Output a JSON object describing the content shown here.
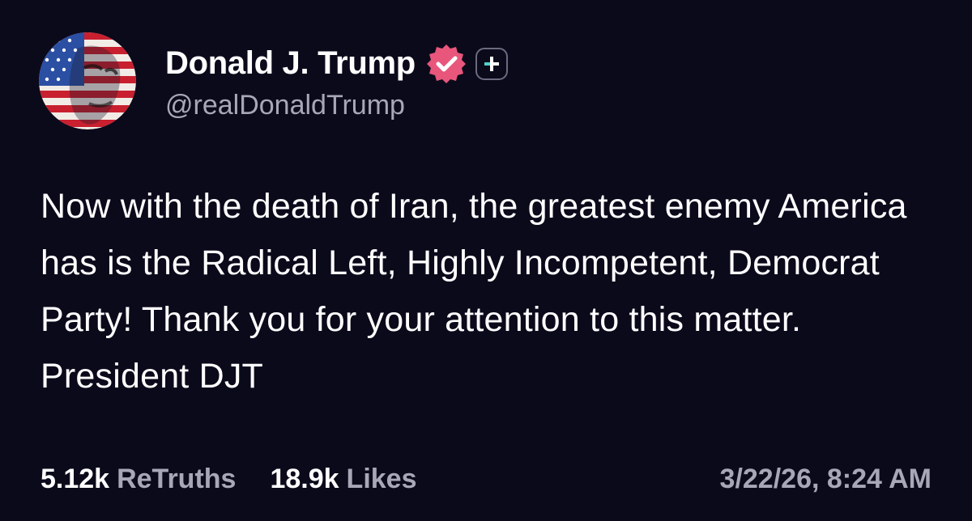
{
  "post": {
    "author": {
      "display_name": "Donald J. Trump",
      "handle": "@realDonaldTrump",
      "verified": true,
      "avatar_icon": "flag-portrait-avatar",
      "verified_icon": "verified-badge-icon",
      "plus_icon": "plus-badge-icon"
    },
    "text": "Now with the death of Iran, the greatest enemy America has is the Radical Left, Highly Incompetent, Democrat Party! Thank you for your attention to this matter. President DJT",
    "stats": {
      "retruths_count": "5.12k",
      "retruths_label": "ReTruths",
      "likes_count": "18.9k",
      "likes_label": "Likes"
    },
    "timestamp": "3/22/26, 8:24 AM"
  },
  "colors": {
    "background": "#0b0a1b",
    "text_primary": "#ffffff",
    "text_secondary": "#a8a7b7",
    "verified_badge": "#e8567c",
    "plus_badge_accent": "#4fd1c5"
  }
}
